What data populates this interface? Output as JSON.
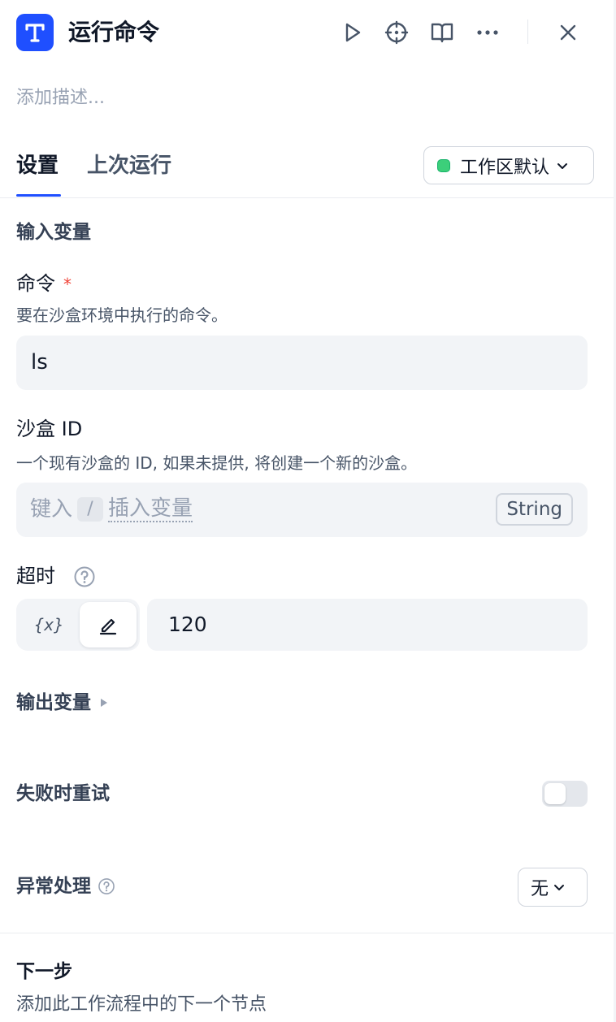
{
  "header": {
    "app_icon": "tool-t-icon",
    "title": "运行命令",
    "actions": [
      "play-icon",
      "crosshair-icon",
      "book-icon",
      "more-icon",
      "close-icon"
    ]
  },
  "description_placeholder": "添加描述...",
  "tabs": [
    {
      "label": "设置",
      "active": true
    },
    {
      "label": "上次运行",
      "active": false
    }
  ],
  "workspace": {
    "label": "工作区默认",
    "status_color": "#3ccf7a"
  },
  "input_section": {
    "title": "输入变量"
  },
  "command": {
    "label": "命令",
    "required_mark": "*",
    "description": "要在沙盒环境中执行的命令。",
    "value": "ls"
  },
  "sandbox_id": {
    "label": "沙盒 ID",
    "description": "一个现有沙盒的 ID, 如果未提供, 将创建一个新的沙盒。",
    "placeholder_prefix": "键入",
    "placeholder_key": "/",
    "placeholder_suffix": "插入变量",
    "type_badge": "String"
  },
  "timeout": {
    "label": "超时",
    "var_toggle_label": "{x}",
    "value": "120"
  },
  "output_section": {
    "title": "输出变量"
  },
  "retry": {
    "label": "失败时重试",
    "enabled": false
  },
  "error_handling": {
    "label": "异常处理",
    "value": "无"
  },
  "next_step": {
    "title": "下一步",
    "description": "添加此工作流程中的下一个节点"
  },
  "colors": {
    "accent": "#1f4fff",
    "required": "#f04438"
  }
}
